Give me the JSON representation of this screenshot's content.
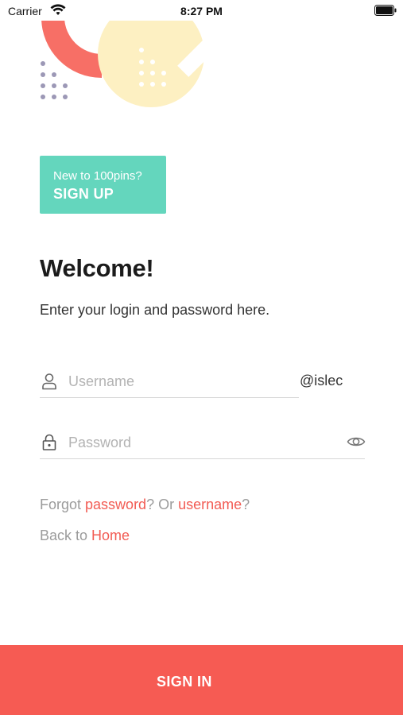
{
  "status_bar": {
    "carrier": "Carrier",
    "time": "8:27 PM"
  },
  "signup": {
    "prompt": "New to 100pins?",
    "cta": "SIGN UP"
  },
  "welcome": {
    "title": "Welcome!",
    "subtitle": "Enter your login and password here."
  },
  "username": {
    "placeholder": "Username",
    "value": "",
    "domain_suffix": "@islec"
  },
  "password": {
    "placeholder": "Password",
    "value": ""
  },
  "help": {
    "forgot_prefix": "Forgot ",
    "password_link": "password",
    "or_text": "? Or ",
    "username_link": "username",
    "question_mark": "?",
    "back_prefix": "Back to ",
    "home_link": "Home"
  },
  "signin": {
    "label": "SIGN IN"
  },
  "colors": {
    "accent": "#f65b53",
    "link": "#f25c54",
    "signup_card": "#64d6bd",
    "deco_yellow": "#fdf0c2",
    "deco_dots": "#9c98b6"
  },
  "icons": [
    "wifi-icon",
    "battery-icon",
    "user-icon",
    "lock-icon",
    "eye-icon",
    "arrow-right-icon"
  ]
}
